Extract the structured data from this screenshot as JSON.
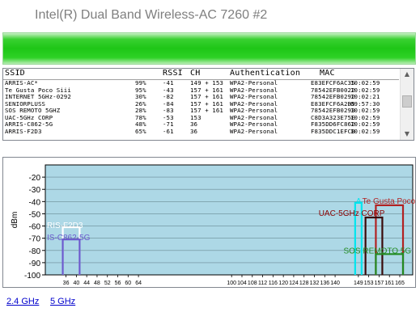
{
  "window": {
    "title": "Intel(R) Dual Band Wireless-AC 7260 #2"
  },
  "list": {
    "headers": {
      "ssid": "SSID",
      "rssi": "RSSI",
      "ch": "CH",
      "auth": "Authentication",
      "mac": "MAC"
    },
    "rows": [
      [
        "ARRIS-AC*",
        "99%",
        "-41",
        "149 + 153",
        "WPA2-Personal",
        "E83EFCF6AC35",
        "10:02:59"
      ],
      [
        "Te Gusta Poco Siii",
        "95%",
        "-43",
        "157 + 161",
        "WPA2-Personal",
        "78542EFB0022",
        "10:02:59"
      ],
      [
        "INTERNET 5GHz-0292",
        "30%",
        "-82",
        "157 + 161",
        "WPA2-Personal",
        "78542EFB0292",
        "10:02:21"
      ],
      [
        "SENIORPLUSS",
        "26%",
        "-84",
        "157 + 161",
        "WPA2-Personal",
        "E83EFCF6A2B5",
        "09:57:30"
      ],
      [
        "SOS REMOTO 5GHZ",
        "28%",
        "-83",
        "157 + 161",
        "WPA2-Personal",
        "78542EFB0293",
        "10:02:59"
      ],
      [
        "UAC-5GHz CORP",
        "78%",
        "-53",
        "153",
        "WPA2-Personal",
        "C8D3A323E75E",
        "10:02:59"
      ],
      [
        "ARRIS-C862-5G",
        "48%",
        "-71",
        "36",
        "WPA2-Personal",
        "F835DD6FC862",
        "10:02:59"
      ],
      [
        "ARRIS-F2D3",
        "65%",
        "-61",
        "36",
        "WPA2-Personal",
        "F835DDC1EFCB",
        "10:02:59"
      ]
    ],
    "scroll_up_icon": "triangle-up",
    "scroll_down_icon": "triangle-down"
  },
  "chart_data": {
    "type": "area",
    "ylabel": "dBm",
    "ylim": [
      -100,
      -10
    ],
    "y_ticks": [
      -20,
      -30,
      -40,
      -50,
      -60,
      -70,
      -80,
      -90,
      -100
    ],
    "x_ticks": [
      "36",
      "40",
      "44",
      "48",
      "52",
      "56",
      "60",
      "64",
      "100",
      "104",
      "108",
      "112",
      "116",
      "120",
      "124",
      "128",
      "132",
      "136",
      "140",
      "149",
      "153",
      "157",
      "161",
      "165"
    ],
    "background": "#add8e6",
    "networks": [
      {
        "label": "ARRIS-F2D3",
        "start_ch": "36",
        "end_ch": "40",
        "dbm": -61,
        "color": "#ffffff"
      },
      {
        "label": "ARRIS-C862-5G",
        "start_ch": "36",
        "end_ch": "40",
        "dbm": -71,
        "color": "#6a5acd"
      },
      {
        "label": "ARRIS-AC*",
        "start_ch": "149",
        "end_ch": "149",
        "dbm": -41,
        "color": "#00e5ee"
      },
      {
        "label": "Te Gusta Poco Siii",
        "start_ch": "157",
        "end_ch": "165",
        "dbm": -43,
        "color": "#b22222"
      },
      {
        "label": "UAC-5GHz CORP",
        "start_ch": "153",
        "end_ch": "157",
        "dbm": -53,
        "color": "#3a0a0a"
      },
      {
        "label": "SOS REMOTO 5GHZ",
        "start_ch": "157",
        "end_ch": "165",
        "dbm": -83,
        "color": "#228b22"
      }
    ],
    "overlay_labels": [
      {
        "text": "A",
        "color": "#00e5ee"
      },
      {
        "text": "Te Gusta Poco S",
        "color": "#b22222"
      },
      {
        "text": "UAC-5GHz CORP",
        "color": "#8b0000"
      },
      {
        "text": "RIS-F2D3",
        "color": "#ffffff"
      },
      {
        "text": "IS-C862-5G",
        "color": "#6a5acd"
      },
      {
        "text": "SOS REMOTO 5G",
        "color": "#228b22"
      }
    ]
  },
  "bands": {
    "band_24": "2.4 GHz",
    "band_5": "5 GHz"
  }
}
